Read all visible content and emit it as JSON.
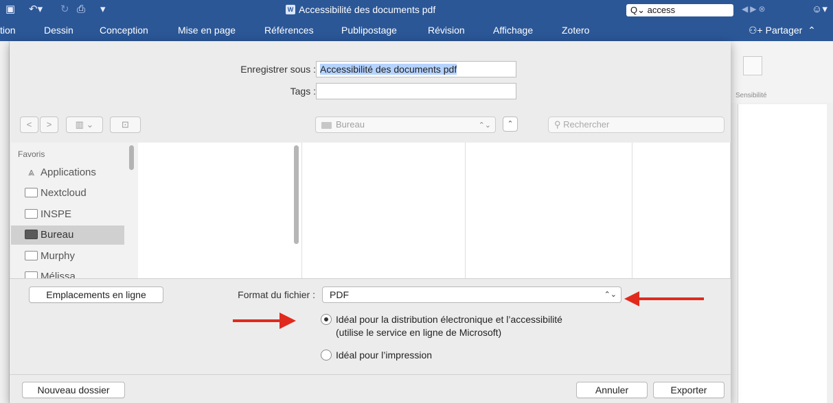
{
  "word": {
    "title": "Accessibilité des documents pdf",
    "search_value": "access",
    "tabs": [
      "tion",
      "Dessin",
      "Conception",
      "Mise en page",
      "Références",
      "Publipostage",
      "Révision",
      "Affichage",
      "Zotero"
    ],
    "share_label": "Partager",
    "sensitivity_label": "Sensibilité"
  },
  "save_dialog": {
    "save_as_label": "Enregistrer sous :",
    "save_as_value": "Accessibilité des documents pdf",
    "tags_label": "Tags :",
    "tags_value": "",
    "location": "Bureau",
    "search_placeholder": "Rechercher",
    "sidebar": {
      "heading": "Favoris",
      "items": [
        {
          "label": "Applications",
          "icon": "applications-icon"
        },
        {
          "label": "Nextcloud",
          "icon": "folder-icon"
        },
        {
          "label": "INSPE",
          "icon": "folder-icon"
        },
        {
          "label": "Bureau",
          "icon": "desktop-folder-icon",
          "selected": true
        },
        {
          "label": "Murphy",
          "icon": "folder-icon"
        },
        {
          "label": "Mélissa",
          "icon": "folder-icon"
        }
      ]
    },
    "online_locations_button": "Emplacements en ligne",
    "format_label": "Format du fichier :",
    "format_value": "PDF",
    "option_distribution_line1": "Idéal pour la distribution électronique et l’accessibilité",
    "option_distribution_line2": "(utilise le service en ligne de Microsoft)",
    "option_distribution_selected": true,
    "option_print": "Idéal pour l’impression",
    "option_print_selected": false,
    "new_folder_button": "Nouveau dossier",
    "cancel_button": "Annuler",
    "export_button": "Exporter"
  },
  "colors": {
    "word_blue": "#2b5797",
    "annotation_arrow": "#e02a1e"
  }
}
